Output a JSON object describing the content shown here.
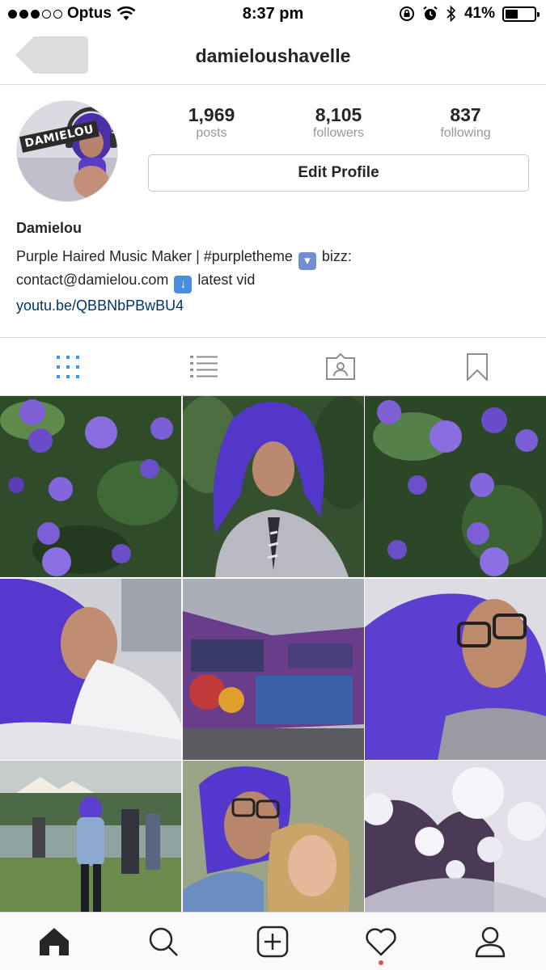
{
  "status_bar": {
    "carrier": "Optus",
    "time": "8:37 pm",
    "battery_percent": "41%",
    "battery_level": 0.41,
    "signal_bars_filled": 3,
    "signal_bars_total": 5
  },
  "nav": {
    "title": "damieloushavelle",
    "back_icon": "back-arrow-icon"
  },
  "profile": {
    "avatar_text": "DAMIELOU",
    "stats": [
      {
        "value": "1,969",
        "label": "posts"
      },
      {
        "value": "8,105",
        "label": "followers"
      },
      {
        "value": "837",
        "label": "following"
      }
    ],
    "edit_button": "Edit Profile",
    "name": "Damielou",
    "bio_line1_pre": "Purple Haired Music Maker | #purpletheme",
    "bio_line1_post": "bizz:",
    "bio_line2_pre": "contact@damielou.com",
    "bio_line2_post": "latest vid",
    "link": "youtu.be/QBBNbPBwBU4"
  },
  "tabs": [
    {
      "icon": "grid-icon",
      "active": true
    },
    {
      "icon": "list-icon",
      "active": false
    },
    {
      "icon": "tagged-icon",
      "active": false
    },
    {
      "icon": "bookmark-icon",
      "active": false
    }
  ],
  "bottom_nav": [
    {
      "icon": "home-icon",
      "active": true
    },
    {
      "icon": "search-icon",
      "active": false
    },
    {
      "icon": "add-post-icon",
      "active": false
    },
    {
      "icon": "heart-icon",
      "active": false,
      "notification": true
    },
    {
      "icon": "profile-icon",
      "active": false
    }
  ],
  "colors": {
    "accent": "#3897f0",
    "link": "#003569",
    "notification": "#ed4956",
    "hair_purple": "#5b3fd1"
  }
}
